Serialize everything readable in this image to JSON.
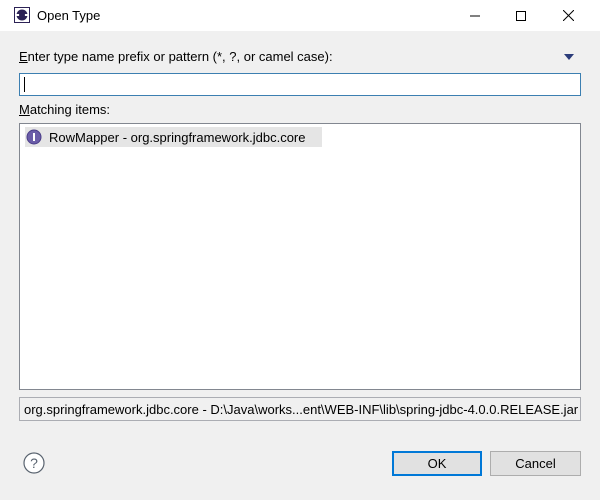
{
  "window": {
    "title": "Open Type"
  },
  "prompt": {
    "label_prefix": "",
    "label_mnemonic": "E",
    "label_rest": "nter type name prefix or pattern (*, ?, or camel case):"
  },
  "search": {
    "value": "",
    "placeholder": ""
  },
  "matching": {
    "label_mnemonic": "M",
    "label_rest": "atching items:",
    "items": [
      {
        "label": "RowMapper - org.springframework.jdbc.core",
        "icon": "interface-icon"
      }
    ]
  },
  "status": {
    "text": "org.springframework.jdbc.core - D:\\Java\\works...ent\\WEB-INF\\lib\\spring-jdbc-4.0.0.RELEASE.jar"
  },
  "buttons": {
    "ok": "OK",
    "cancel": "Cancel"
  },
  "colors": {
    "focus_border": "#0078d7",
    "selection": "#e5e5e5",
    "interface_icon": "#6a5ca8"
  }
}
